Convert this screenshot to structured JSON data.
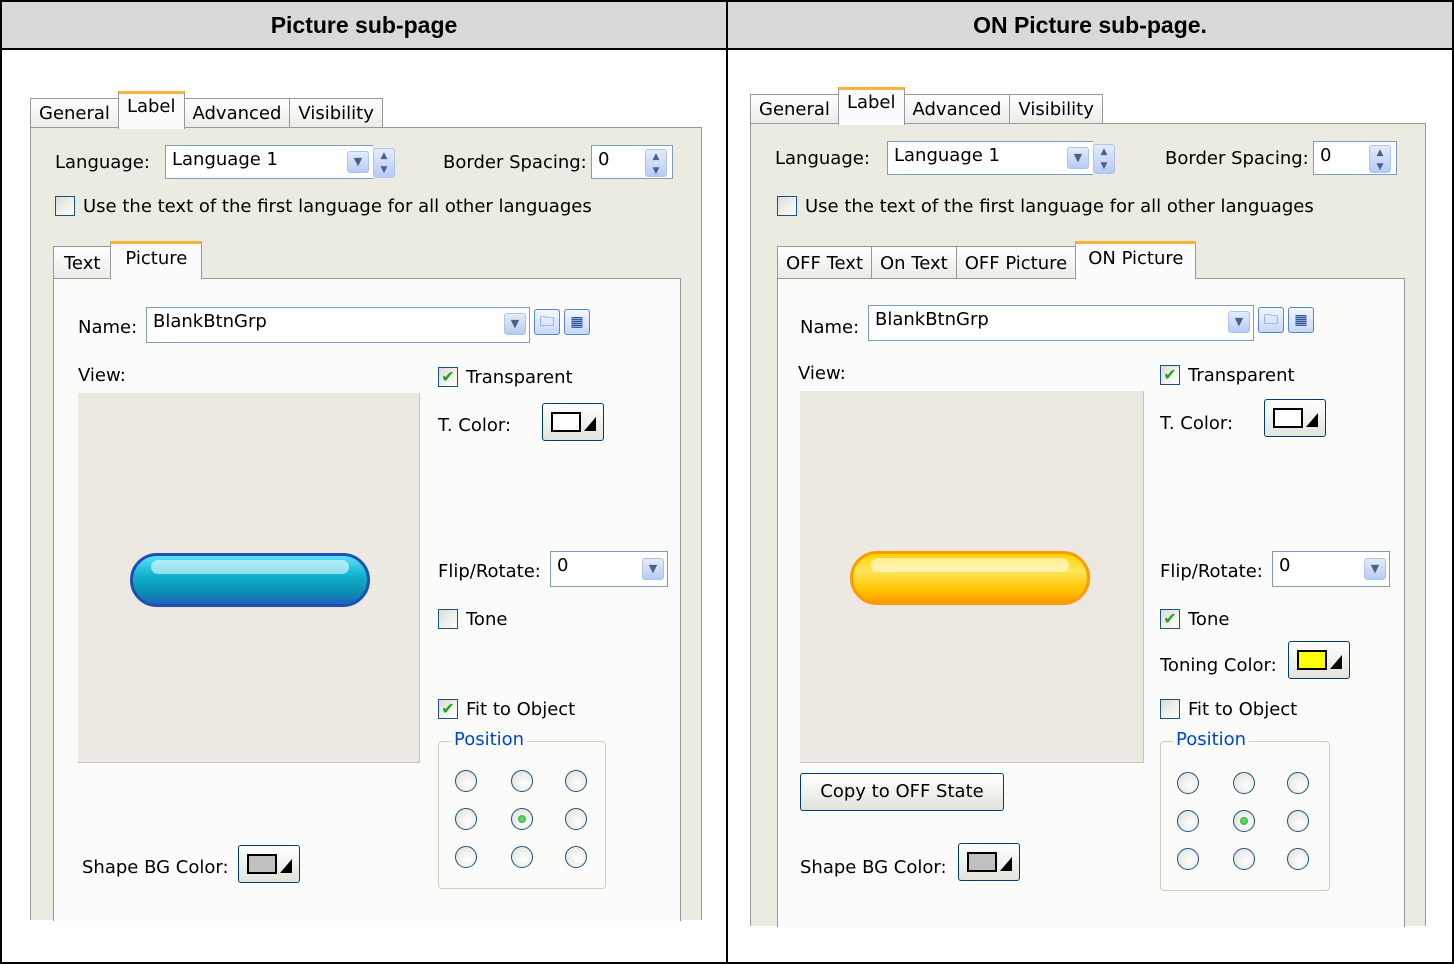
{
  "headers": {
    "left": "Picture sub-page",
    "right": "ON Picture sub-page."
  },
  "left": {
    "tabs": [
      "General",
      "Label",
      "Advanced",
      "Visibility"
    ],
    "language_label": "Language:",
    "language_value": "Language 1",
    "border_spacing_label": "Border Spacing:",
    "border_spacing_value": "0",
    "use_first_lang_label": "Use the text of the first language for all other languages",
    "sub_tabs": [
      "Text",
      "Picture"
    ],
    "name_label": "Name:",
    "name_value": "BlankBtnGrp",
    "view_label": "View:",
    "transparent_label": "Transparent",
    "t_color_label": "T. Color:",
    "flip_rotate_label": "Flip/Rotate:",
    "flip_rotate_value": "0",
    "tone_label": "Tone",
    "fit_label": "Fit to Object",
    "position_label": "Position",
    "shape_bg_label": "Shape BG Color:"
  },
  "right": {
    "tabs": [
      "General",
      "Label",
      "Advanced",
      "Visibility"
    ],
    "language_label": "Language:",
    "language_value": "Language 1",
    "border_spacing_label": "Border Spacing:",
    "border_spacing_value": "0",
    "use_first_lang_label": "Use the text of the first language for all other languages",
    "sub_tabs": [
      "OFF Text",
      "On Text",
      "OFF Picture",
      "ON Picture"
    ],
    "name_label": "Name:",
    "name_value": "BlankBtnGrp",
    "view_label": "View:",
    "transparent_label": "Transparent",
    "t_color_label": "T. Color:",
    "flip_rotate_label": "Flip/Rotate:",
    "flip_rotate_value": "0",
    "tone_label": "Tone",
    "toning_color_label": "Toning Color:",
    "fit_label": "Fit to Object",
    "position_label": "Position",
    "copy_button_label": "Copy to OFF State",
    "shape_bg_label": "Shape BG Color:"
  },
  "colors": {
    "toning": "#ffff00",
    "t_color": "#ffffff",
    "shape_bg": "#c0c0c0"
  }
}
